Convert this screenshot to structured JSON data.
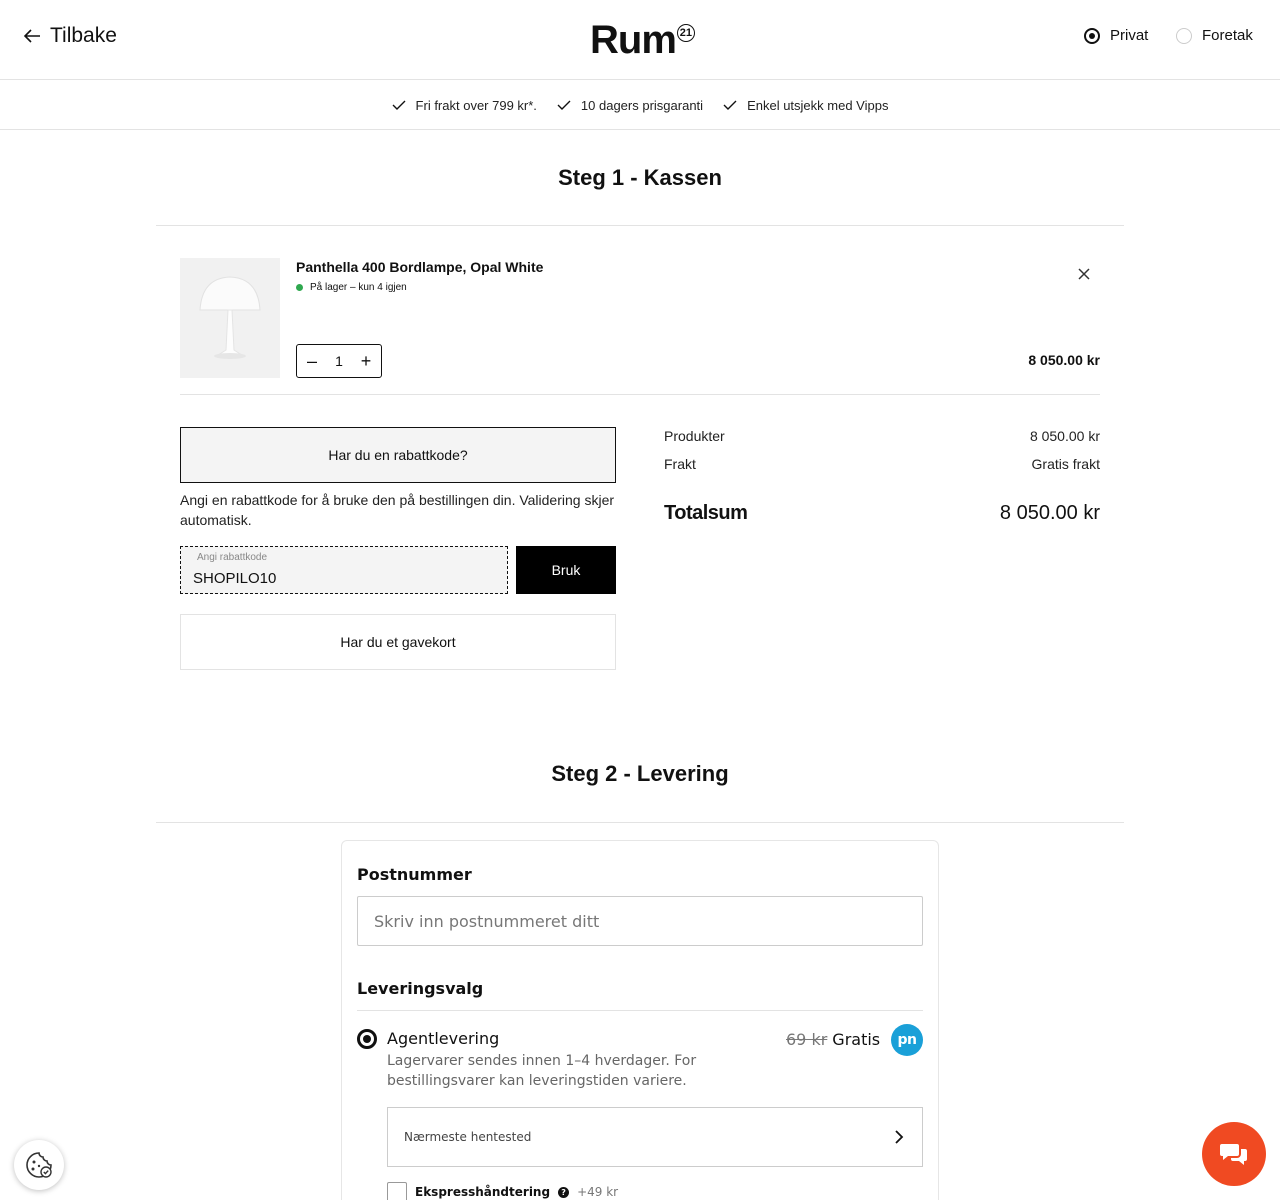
{
  "header": {
    "back_label": "Tilbake",
    "logo_text": "Rum",
    "logo_sup": "21",
    "customer_types": [
      {
        "label": "Privat",
        "selected": true
      },
      {
        "label": "Foretak",
        "selected": false
      }
    ]
  },
  "usp": [
    "Fri frakt over 799 kr*.",
    "10 dagers prisgaranti",
    "Enkel utsjekk med Vipps"
  ],
  "step1": {
    "title": "Steg 1 - Kassen",
    "item": {
      "name": "Panthella 400 Bordlampe, Opal White",
      "stock": "På lager – kun 4 igjen",
      "quantity": "1",
      "price": "8 050.00 kr"
    },
    "discount": {
      "toggle_label": "Har du en rabattkode?",
      "help_text": "Angi en rabattkode for å bruke den på bestillingen din. Validering skjer automatisk.",
      "field_label": "Angi rabattkode",
      "field_value": "SHOPILO10",
      "apply_label": "Bruk"
    },
    "giftcard_label": "Har du et gavekort",
    "summary": {
      "products_label": "Produkter",
      "products_value": "8 050.00 kr",
      "shipping_label": "Frakt",
      "shipping_value": "Gratis frakt",
      "total_label": "Totalsum",
      "total_value": "8 050.00 kr"
    }
  },
  "step2": {
    "title": "Steg 2 - Levering",
    "postcode_label": "Postnummer",
    "postcode_placeholder": "Skriv inn postnummeret ditt",
    "options_label": "Leveringsvalg",
    "option": {
      "name": "Agentlevering",
      "description": "Lagervarer sendes innen 1–4 hverdager. For bestillingsvarer kan leveringstiden variere.",
      "old_price": "69 kr",
      "price": "Gratis",
      "carrier_logo": "pn",
      "pickup_label": "Nærmeste hentested",
      "express_label": "Ekspresshåndtering",
      "express_price": "+49 kr"
    }
  },
  "colors": {
    "accent": "#000000",
    "stock_green": "#2fa84f",
    "chat": "#f04a22",
    "carrier": "#1aa0d8"
  },
  "icons": [
    "arrow-left-icon",
    "check-icon",
    "close-icon",
    "chevron-right-icon",
    "help-icon",
    "cookie-icon",
    "chat-icon"
  ]
}
